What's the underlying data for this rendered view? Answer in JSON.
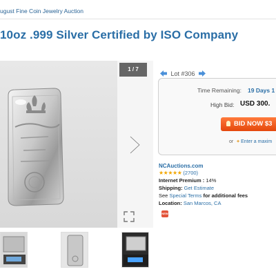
{
  "header": {
    "breadcrumb": "ugust Fine Coin Jewelry Auction",
    "title": "10oz .999 Silver Certified by ISO Company"
  },
  "gallery": {
    "counter": "1 / 7",
    "thumbnails": [
      "silver bar on digital scale",
      "silver bar",
      "silver bar on scale"
    ]
  },
  "lot": {
    "label": "Lot #306"
  },
  "bidding": {
    "time_remaining_label": "Time Remaining:",
    "time_remaining_value": "19 Days 1",
    "high_bid_label": "High Bid:",
    "high_bid_value": "USD 300.",
    "bid_button_label": "BID NOW $3",
    "or_text": "or",
    "max_bid_link": "Enter a maxim"
  },
  "seller": {
    "auctioneer": "NCAuctions.com",
    "rating_stars": 4.5,
    "rating_count": "(2700)",
    "internet_premium_label": "Internet Premium :",
    "internet_premium_value": "14%",
    "shipping_label": "Shipping:",
    "shipping_link": "Get Estimate",
    "see_text": "See",
    "special_terms_link": "Special Terms",
    "additional_fees_text": "for additional fees",
    "location_label": "Location:",
    "location_value": "San Marcos, CA"
  },
  "colors": {
    "accent": "#2a6ea6",
    "bid_button": "#f05a1a",
    "stars": "#f2a600"
  },
  "icons": {
    "prev_lot": "blue-left-arrow-icon",
    "next_lot": "blue-right-arrow-icon",
    "next_image": "chevron-right-icon",
    "expand": "expand-icon",
    "max_bid": "plus-icon",
    "new_badge": "new-badge-icon"
  }
}
